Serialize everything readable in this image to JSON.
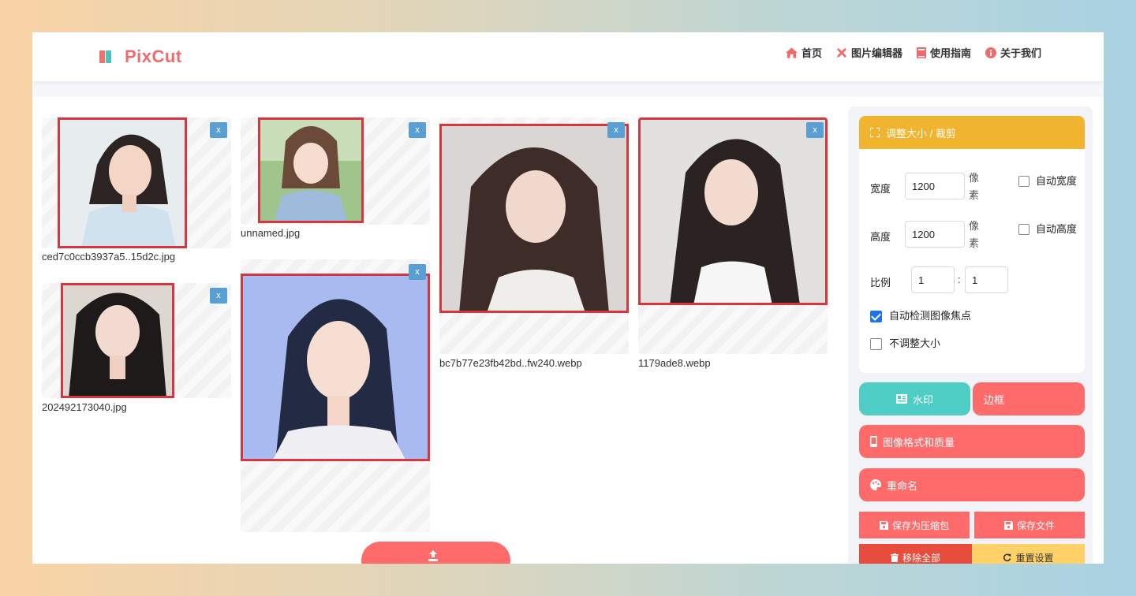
{
  "brand": {
    "name": "PixCut"
  },
  "nav": [
    {
      "label": "首页",
      "icon": "home-icon"
    },
    {
      "label": "图片编辑器",
      "icon": "tools-icon"
    },
    {
      "label": "使用指南",
      "icon": "book-icon"
    },
    {
      "label": "关于我们",
      "icon": "info-icon"
    }
  ],
  "images": [
    {
      "filename": "ced7c0ccb3937a5..15d2c.jpg",
      "remove": "x"
    },
    {
      "filename": "unnamed.jpg",
      "remove": "x"
    },
    {
      "filename": "bc7b77e23fb42bd..fw240.webp",
      "remove": "x"
    },
    {
      "filename": "1179ade8.webp",
      "remove": "x"
    },
    {
      "filename": "202492173040.jpg",
      "remove": "x"
    },
    {
      "filename": "",
      "remove": "x"
    }
  ],
  "resize_panel": {
    "title": "调整大小 / 裁剪",
    "width_label": "宽度",
    "width_value": "1200",
    "height_label": "高度",
    "height_value": "1200",
    "unit": "像素",
    "auto_width": "自动宽度",
    "auto_height": "自动高度",
    "ratio_label": "比例",
    "ratio_a": "1",
    "ratio_sep": ":",
    "ratio_b": "1",
    "auto_focus": "自动检测图像焦点",
    "auto_focus_checked": true,
    "no_resize": "不调整大小",
    "no_resize_checked": false
  },
  "buttons": {
    "watermark": "水印",
    "border": "边框",
    "format_quality": "图像格式和质量",
    "rename": "重命名",
    "save_zip": "保存为压缩包",
    "save_file": "保存文件",
    "remove_all": "移除全部",
    "reset": "重置设置"
  },
  "colors": {
    "brand": "#f06b6b",
    "panel_header": "#f1b42e",
    "watermark": "#4ecdc4",
    "coral": "#ff6b6b",
    "remove_all": "#e74c3c",
    "reset": "#ffd166",
    "crop_frame": "#d6363f",
    "remove_x": "#5a9fd4"
  }
}
